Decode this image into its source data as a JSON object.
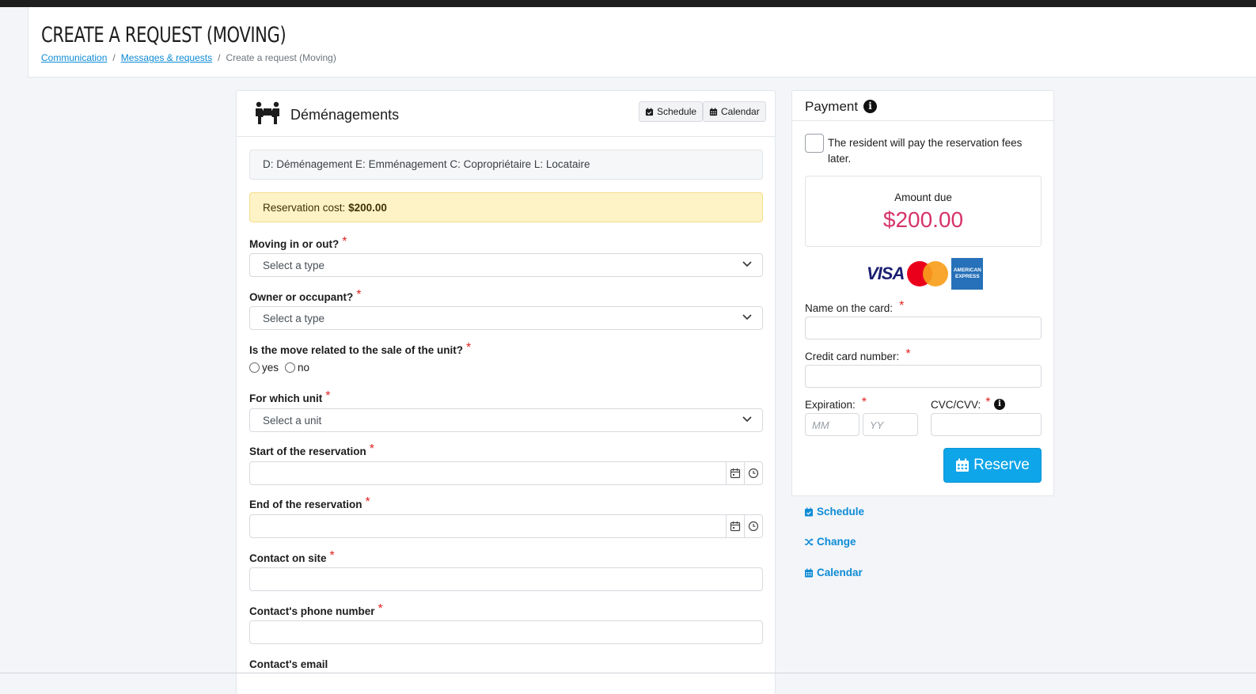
{
  "page": {
    "title": "CREATE A REQUEST (MOVING)",
    "breadcrumb": [
      "Communication",
      "Messages & requests",
      "Create a request (Moving)"
    ]
  },
  "main": {
    "title": "Déménagements",
    "buttons": {
      "schedule": "Schedule",
      "calendar": "Calendar"
    },
    "legend": "D: Déménagement E: Emménagement C: Copropriétaire L: Locataire",
    "cost_label": "Reservation cost:",
    "cost_value": "$200.00",
    "required_mark": "*",
    "fields": {
      "moving": {
        "label": "Moving in or out?",
        "value": "Select a type"
      },
      "owner": {
        "label": "Owner or occupant?",
        "value": "Select a type"
      },
      "sale": {
        "label": "Is the move related to the sale of the unit?",
        "options": [
          "yes",
          "no"
        ]
      },
      "unit": {
        "label": "For which unit",
        "value": "Select a unit"
      },
      "start": {
        "label": "Start of the reservation",
        "value": ""
      },
      "end": {
        "label": "End of the reservation",
        "value": ""
      },
      "contact": {
        "label": "Contact on site",
        "value": ""
      },
      "phone": {
        "label": "Contact's phone number",
        "value": ""
      },
      "email": {
        "label": "Contact's email"
      }
    }
  },
  "payment": {
    "title": "Payment",
    "info_symbol": "i",
    "later_label": "The resident will pay the reservation fees later.",
    "amount_label": "Amount due",
    "amount_value": "$200.00",
    "card_brands": [
      "VISA",
      "mastercard",
      "AMERICAN EXPRESS"
    ],
    "name_label": "Name on the card:",
    "number_label": "Credit card number:",
    "expiration_label": "Expiration:",
    "mm_placeholder": "MM",
    "yy_placeholder": "YY",
    "cvc_label": "CVC/CVV:",
    "reserve_label": "Reserve",
    "accent_color": "#0ea5e9",
    "amount_color": "#d6336c"
  },
  "side_links": {
    "schedule": "Schedule",
    "change": "Change",
    "calendar": "Calendar"
  }
}
